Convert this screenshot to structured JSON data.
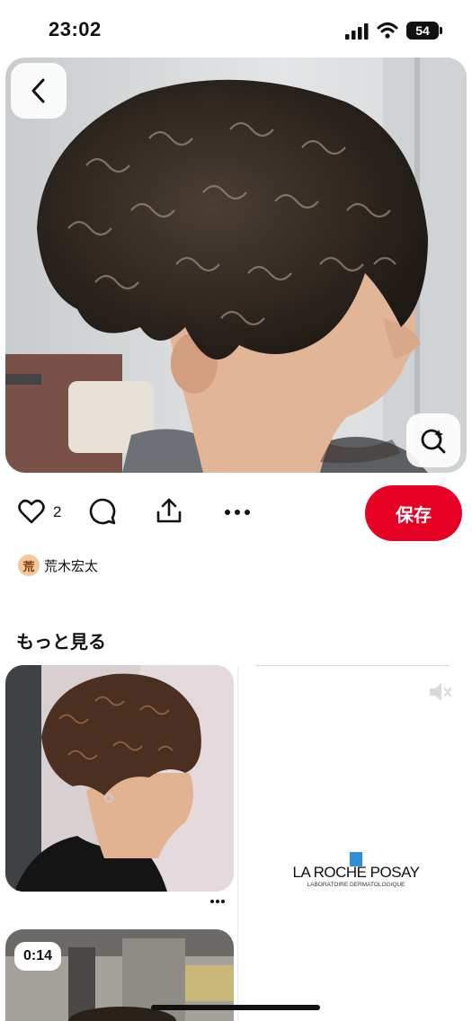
{
  "status_bar": {
    "time": "23:02",
    "battery": "54"
  },
  "pin": {
    "like_count": "2",
    "save_label": "保存",
    "author": {
      "avatar_letter": "荒",
      "name": "荒木宏太"
    }
  },
  "more_section": {
    "heading": "もっと見る",
    "video_duration": "0:14",
    "ad": {
      "brand_main": "LA ROCHE POSAY",
      "brand_sub": "LABORATOIRE DERMATOLOGIQUE"
    }
  },
  "colors": {
    "accent": "#e60023"
  },
  "icons": [
    "chevron-left-icon",
    "visual-search-icon",
    "heart-icon",
    "comment-icon",
    "share-icon",
    "more-icon",
    "mute-icon"
  ]
}
